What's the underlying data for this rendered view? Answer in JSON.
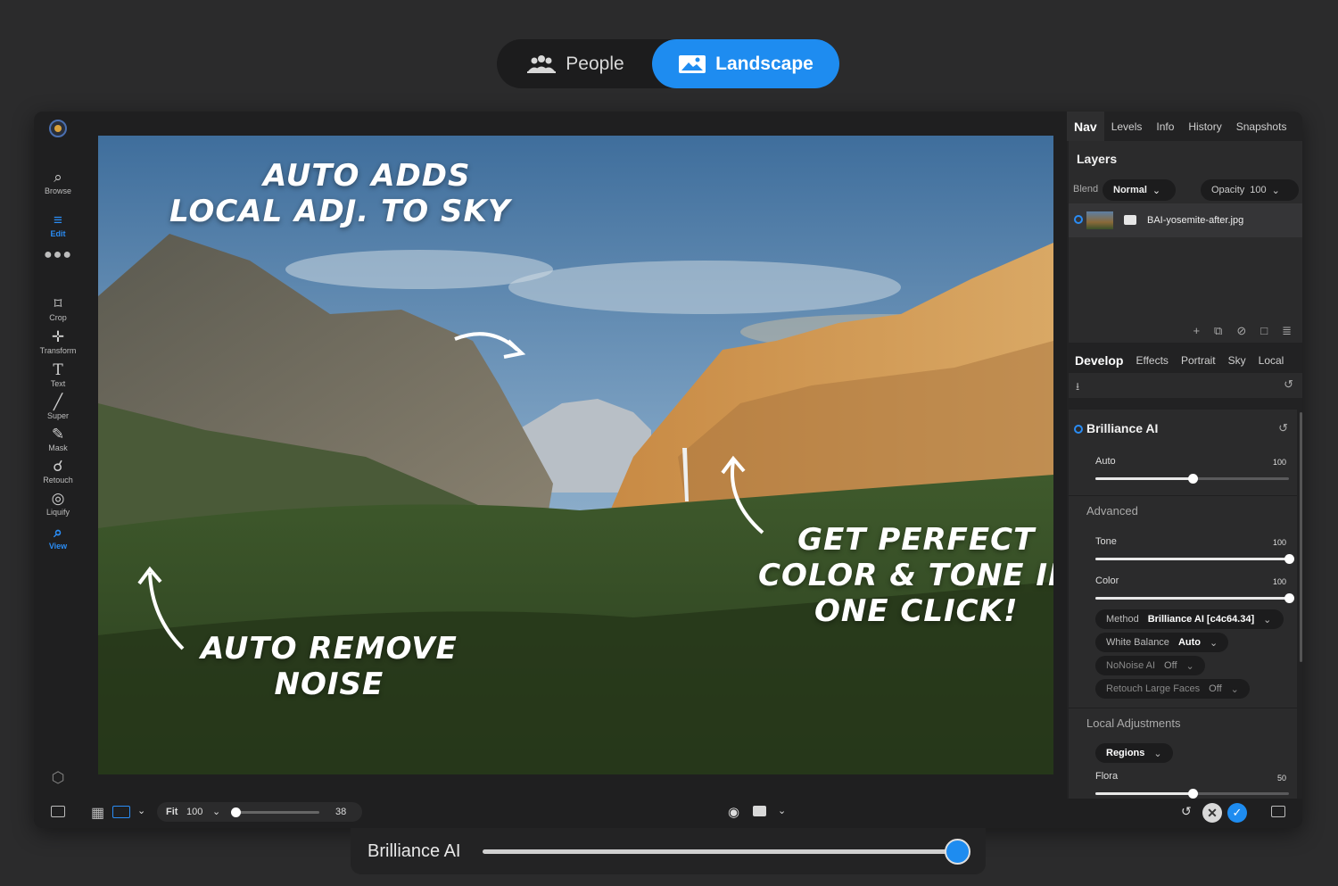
{
  "mode_toggle": {
    "people_label": "People",
    "landscape_label": "Landscape",
    "selected": "Landscape"
  },
  "tools": [
    {
      "label": "Browse",
      "icon": "browse-icon"
    },
    {
      "label": "Edit",
      "icon": "sliders-icon",
      "active": true
    },
    {
      "label": "Crop",
      "icon": "crop-icon"
    },
    {
      "label": "Transform",
      "icon": "move-icon"
    },
    {
      "label": "Text",
      "icon": "text-icon"
    },
    {
      "label": "Super",
      "icon": "wand-icon"
    },
    {
      "label": "Mask",
      "icon": "brush-icon"
    },
    {
      "label": "Retouch",
      "icon": "retouch-icon"
    },
    {
      "label": "Liquify",
      "icon": "liquify-icon"
    },
    {
      "label": "View",
      "icon": "view-icon",
      "active": true
    }
  ],
  "annotations": {
    "sky": [
      "Auto Adds",
      "Local Adj. To Sky"
    ],
    "noise": [
      "Auto Remove",
      "Noise"
    ],
    "color": [
      "Get Perfect",
      "Color & Tone In",
      "One Click!"
    ]
  },
  "panel": {
    "tabs": [
      "Nav",
      "Levels",
      "Info",
      "History",
      "Snapshots"
    ],
    "active_tab": "Nav",
    "layers": {
      "title": "Layers",
      "blend_label": "Blend",
      "blend_value": "Normal",
      "opacity_label": "Opacity",
      "opacity_value": "100",
      "layer_name": "BAI-yosemite-after.jpg"
    },
    "develop_tabs": [
      "Develop",
      "Effects",
      "Portrait",
      "Sky",
      "Local"
    ],
    "active_develop_tab": "Develop",
    "brilliance": {
      "title": "Brilliance AI",
      "auto_label": "Auto",
      "auto_value": "100",
      "auto_level": 0.5,
      "advanced_label": "Advanced",
      "tone_label": "Tone",
      "tone_value": "100",
      "tone_level": 1.0,
      "color_label": "Color",
      "color_value": "100",
      "color_level": 1.0,
      "method_label": "Method",
      "method_value": "Brilliance AI [c4c64.34]",
      "wb_label": "White Balance",
      "wb_value": "Auto",
      "nonoise_label": "NoNoise AI",
      "nonoise_value": "Off",
      "retouch_label": "Retouch Large Faces",
      "retouch_value": "Off"
    },
    "local": {
      "title": "Local Adjustments",
      "regions_label": "Regions",
      "flora_label": "Flora",
      "flora_value": "50",
      "flora_level": 0.5
    }
  },
  "bottom_bar": {
    "fit_label": "Fit",
    "zoom_value": "100",
    "size_value": "38",
    "size_level": 0.0
  },
  "brilliance_slider": {
    "label": "Brilliance AI",
    "level": 1.0
  },
  "colors": {
    "accent": "#1e8cf0",
    "background": "#2b2b2c",
    "window": "#1f1f20"
  }
}
